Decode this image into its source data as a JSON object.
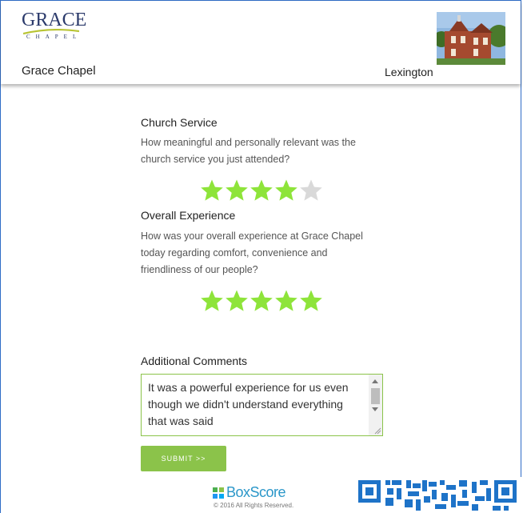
{
  "header": {
    "logo_word": "GRACE",
    "logo_sub": "CHAPEL",
    "church_name": "Grace Chapel",
    "location": "Lexington"
  },
  "questions": [
    {
      "title": "Church Service",
      "text": "How meaningful and personally relevant was the church service you just attended?",
      "rating": 4,
      "max": 5
    },
    {
      "title": "Overall Experience",
      "text": "How was your overall experience at Grace Chapel today regarding comfort, convenience and friendliness of our people?",
      "rating": 5,
      "max": 5
    }
  ],
  "comments": {
    "title": "Additional Comments",
    "value": "It was a powerful experience for us even though we didn't understand everything that was said"
  },
  "submit_label": "SUBMIT >>",
  "footer": {
    "brand": "BoxScore",
    "copyright": "© 2016 All Rights Reserved."
  },
  "colors": {
    "star_on": "#8ee43a",
    "star_off": "#d9d9d9",
    "accent": "#8bc34a",
    "frame": "#2f6cc6",
    "qr": "#1e73c8"
  }
}
